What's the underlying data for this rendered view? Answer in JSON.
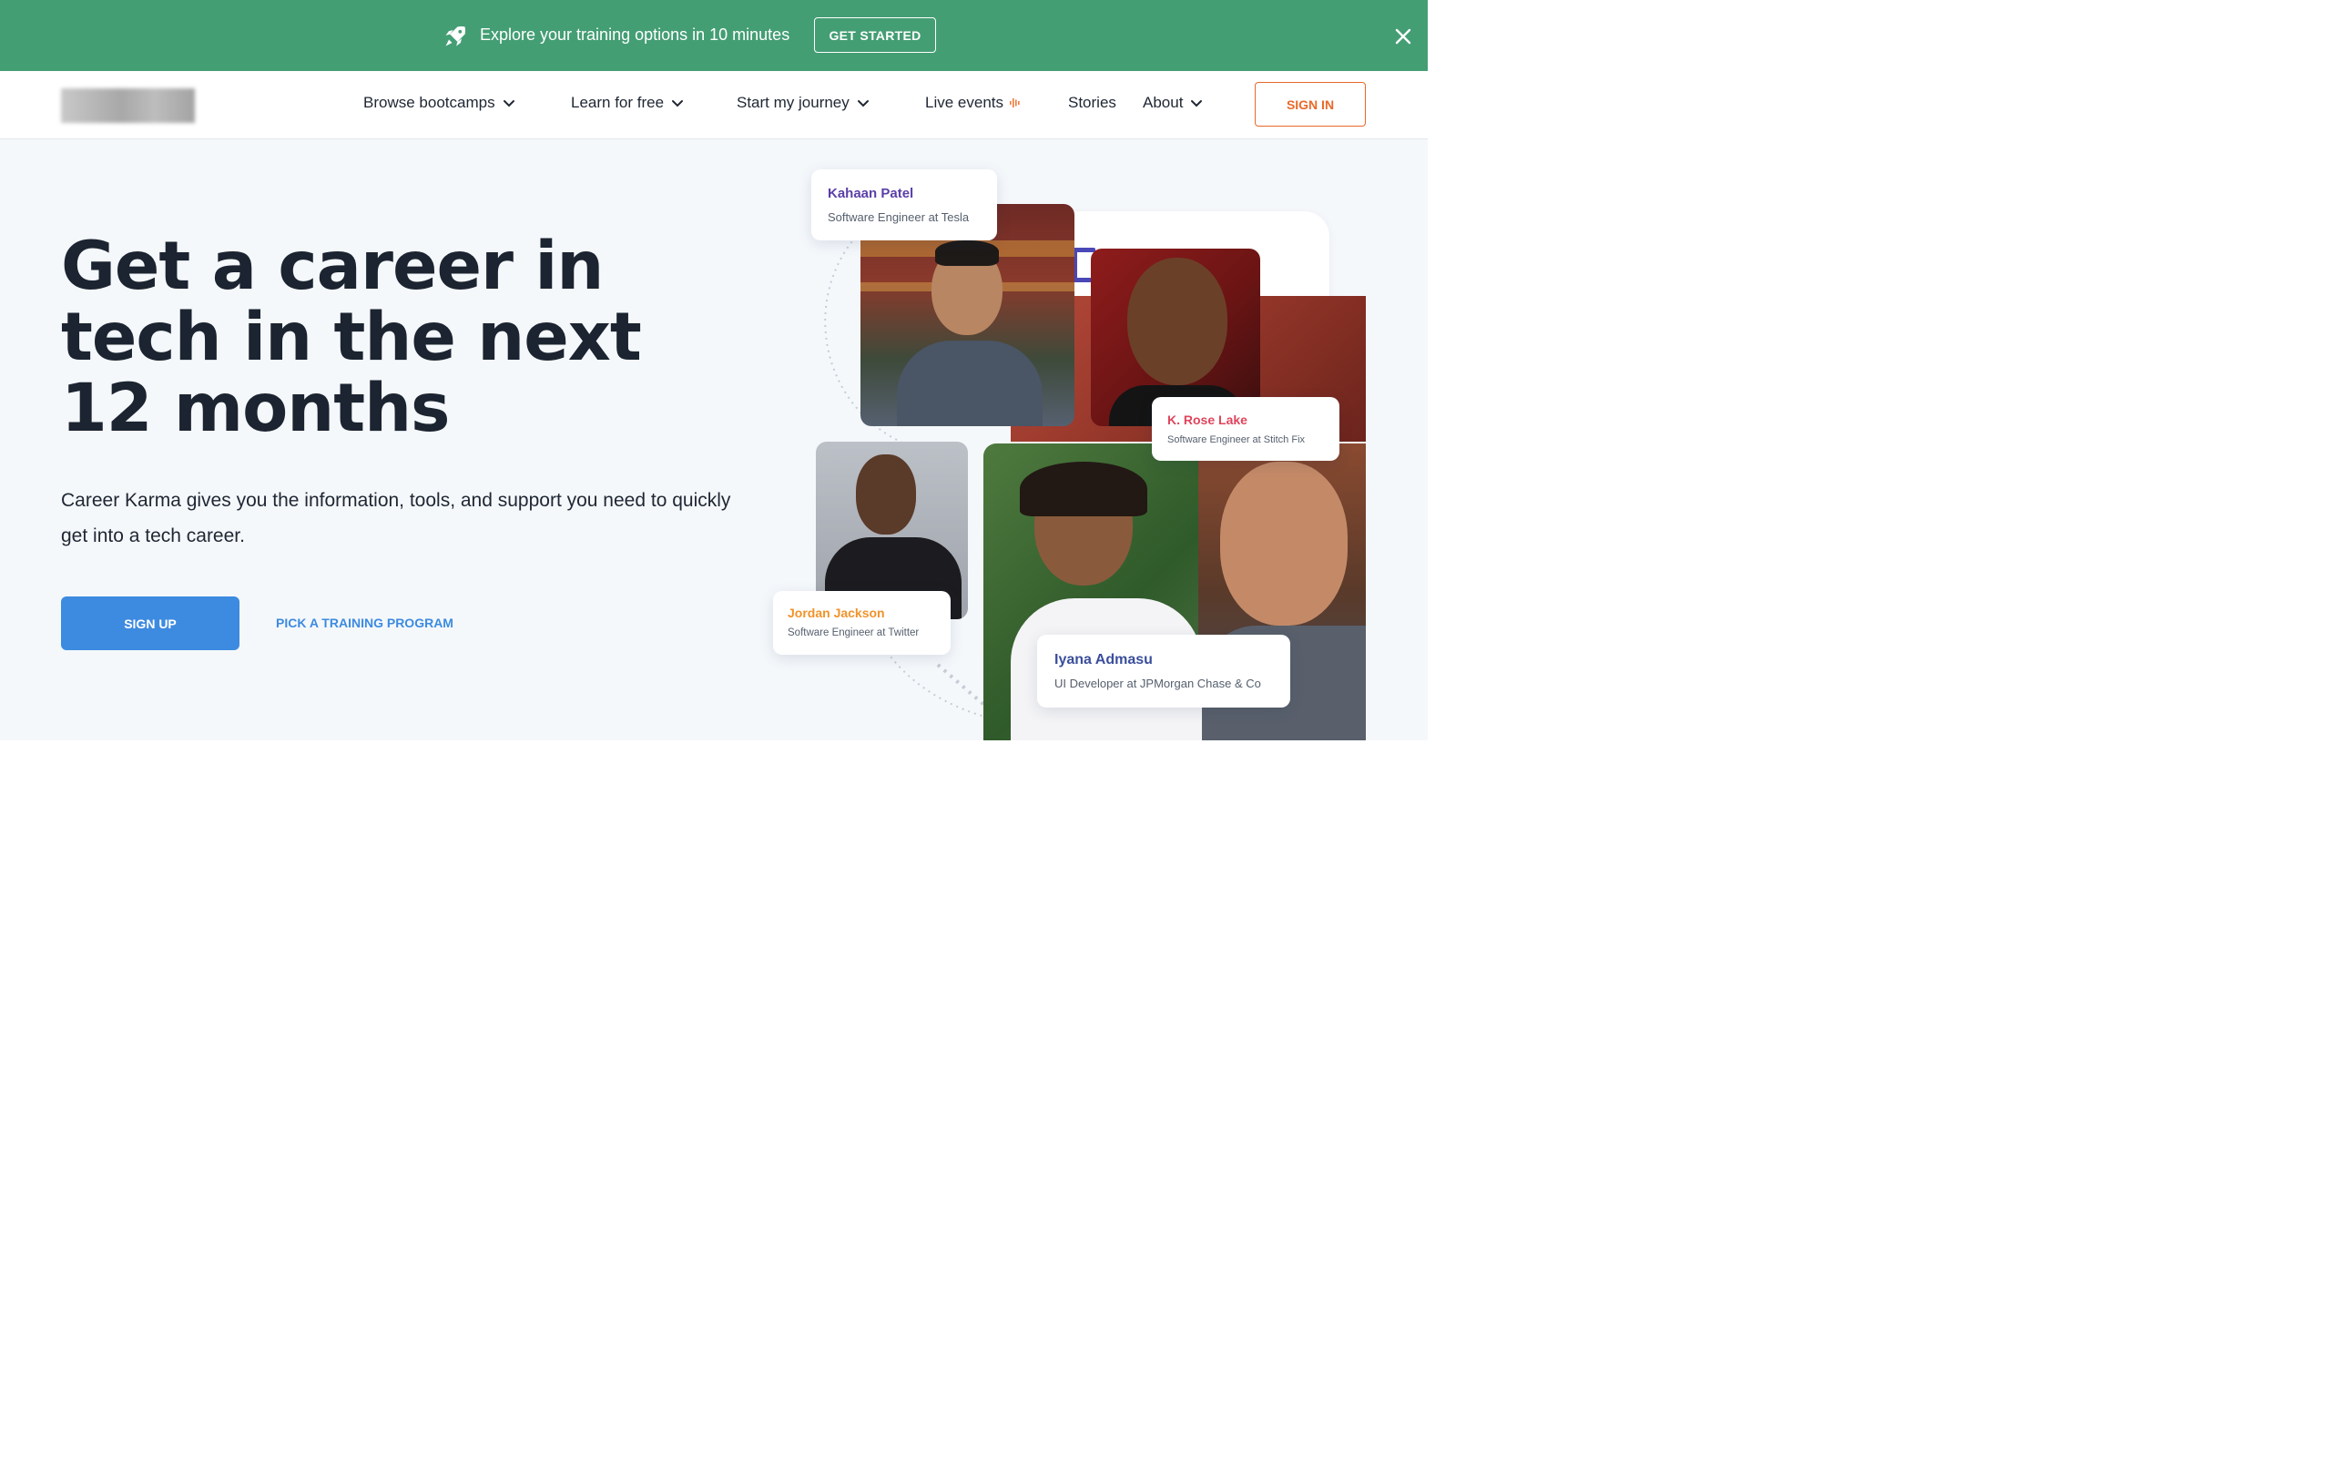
{
  "banner": {
    "text": "Explore your training options in 10 minutes",
    "button": "GET STARTED",
    "bg_color": "#449e74",
    "icons": [
      "rocket-icon",
      "close-icon"
    ]
  },
  "nav": {
    "items": [
      {
        "label": "Browse bootcamps",
        "has_dropdown": true
      },
      {
        "label": "Learn for free",
        "has_dropdown": true
      },
      {
        "label": "Start my journey",
        "has_dropdown": true
      },
      {
        "label": "Live events",
        "icon": "live-audio-icon"
      },
      {
        "label": "Stories"
      },
      {
        "label": "About",
        "has_dropdown": true
      }
    ],
    "signin": "SIGN IN",
    "signin_color": "#e8692a"
  },
  "hero": {
    "headline": "Get a career in tech in the next 12 months",
    "subtext": "Career Karma gives you the information, tools, and support you need to quickly get into a tech career.",
    "signup": "SIGN UP",
    "pick_program": "PICK A TRAINING PROGRAM",
    "accent_color": "#3d8be0"
  },
  "testimonials": [
    {
      "name": "Kahaan Patel",
      "role": "Software Engineer at Tesla",
      "name_color": "#5b3fa8"
    },
    {
      "name": "K. Rose Lake",
      "role": "Software Engineer at Stitch Fix",
      "name_color": "#e0445c"
    },
    {
      "name": "Jordan Jackson",
      "role": "Software Engineer at Twitter",
      "name_color": "#f0932b"
    },
    {
      "name": "Iyana Admasu",
      "role": "UI Developer at JPMorgan Chase & Co",
      "name_color": "#3a4e9c"
    }
  ]
}
